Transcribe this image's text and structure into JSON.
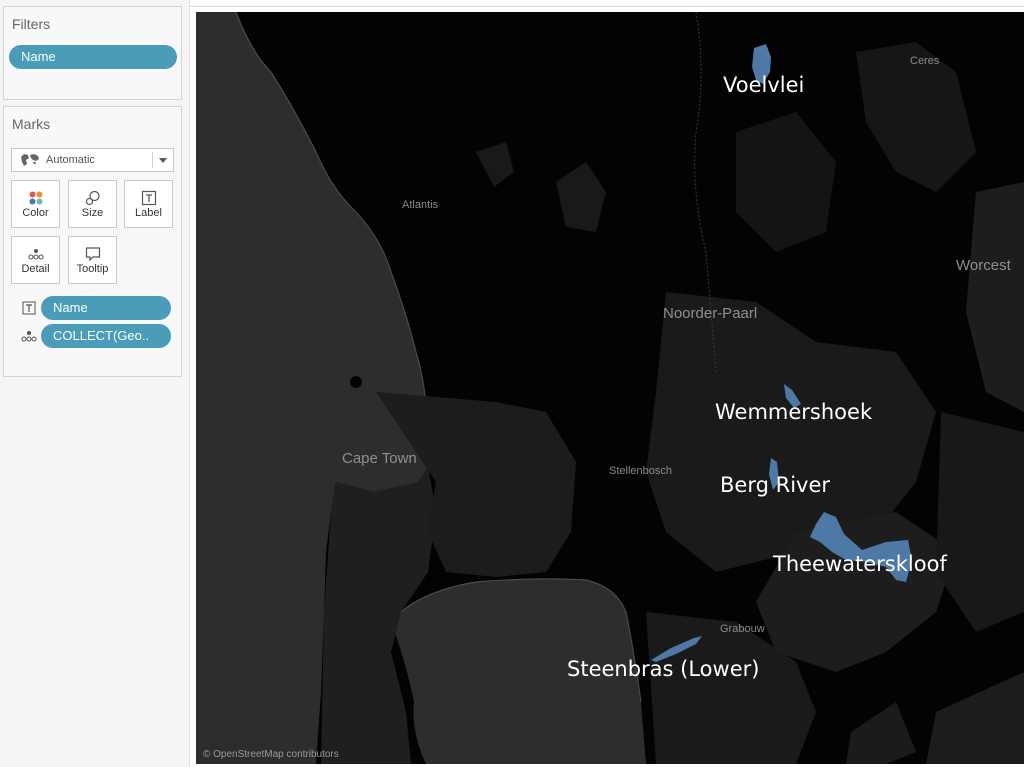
{
  "filters": {
    "title": "Filters",
    "pills": [
      "Name"
    ]
  },
  "marks": {
    "title": "Marks",
    "mark_type": {
      "selected": "Automatic",
      "icon": "map-icon"
    },
    "buttons": [
      {
        "label": "Color",
        "icon": "color-icon"
      },
      {
        "label": "Size",
        "icon": "size-icon"
      },
      {
        "label": "Label",
        "icon": "label-icon"
      },
      {
        "label": "Detail",
        "icon": "detail-icon"
      },
      {
        "label": "Tooltip",
        "icon": "tooltip-icon"
      }
    ],
    "fields": [
      {
        "label": "Name",
        "icon": "label-icon"
      },
      {
        "label": "COLLECT(Geo..",
        "icon": "detail-icon"
      }
    ]
  },
  "map": {
    "attribution": "© OpenStreetMap contributors",
    "place_labels": [
      "Ceres",
      "Atlantis",
      "Worcest",
      "Noorder-Paarl",
      "Cape Town",
      "Stellenbosch",
      "Grabouw"
    ],
    "reservoirs": [
      "Voelvlei",
      "Wemmershoek",
      "Berg River",
      "Theewaterskloof",
      "Steenbras (Lower)"
    ],
    "colors": {
      "background": "#030303",
      "land": "#1b1b1b",
      "ocean": "#2d2d2d",
      "reservoir": "#4e79a7"
    }
  }
}
